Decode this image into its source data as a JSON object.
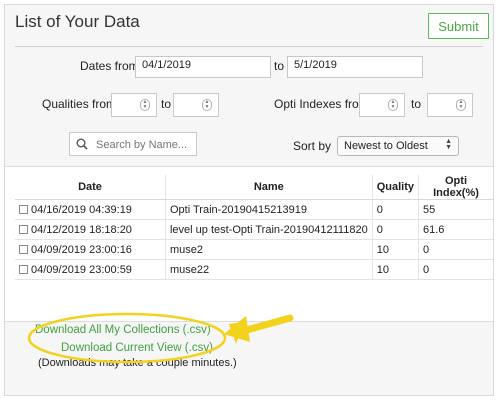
{
  "header": {
    "title": "List of Your Data",
    "submit_label": "Submit"
  },
  "filters": {
    "dates_from_label": "Dates from",
    "date_from_value": "04/1/2019",
    "date_to_label": "to",
    "date_to_value": "5/1/2019",
    "qualities_from_label": "Qualities from",
    "qualities_to_label": "to",
    "opti_from_label": "Opti Indexes from",
    "opti_to_label": "to"
  },
  "search": {
    "placeholder": "Search by Name..."
  },
  "sort": {
    "label": "Sort by",
    "selected": "Newest to Oldest"
  },
  "table": {
    "headers": [
      "Date",
      "Name",
      "Quality",
      "Opti Index(%)"
    ],
    "rows": [
      {
        "date": "04/16/2019 04:39:19",
        "name": "Opti Train-20190415213919",
        "quality": "0",
        "opti": "55"
      },
      {
        "date": "04/12/2019 18:18:20",
        "name": "level up test-Opti Train-20190412111820",
        "quality": "0",
        "opti": "61.6"
      },
      {
        "date": "04/09/2019 23:00:16",
        "name": "muse2",
        "quality": "10",
        "opti": "0"
      },
      {
        "date": "04/09/2019 23:00:59",
        "name": "muse22",
        "quality": "10",
        "opti": "0"
      }
    ]
  },
  "downloads": {
    "all_label": "Download All My Collections (.csv)",
    "current_label": "Download Current View (.csv)",
    "note": "(Downloads may take a couple minutes.)"
  },
  "colors": {
    "accent_green": "#4aa64a",
    "highlight_yellow": "#f2d21b"
  }
}
